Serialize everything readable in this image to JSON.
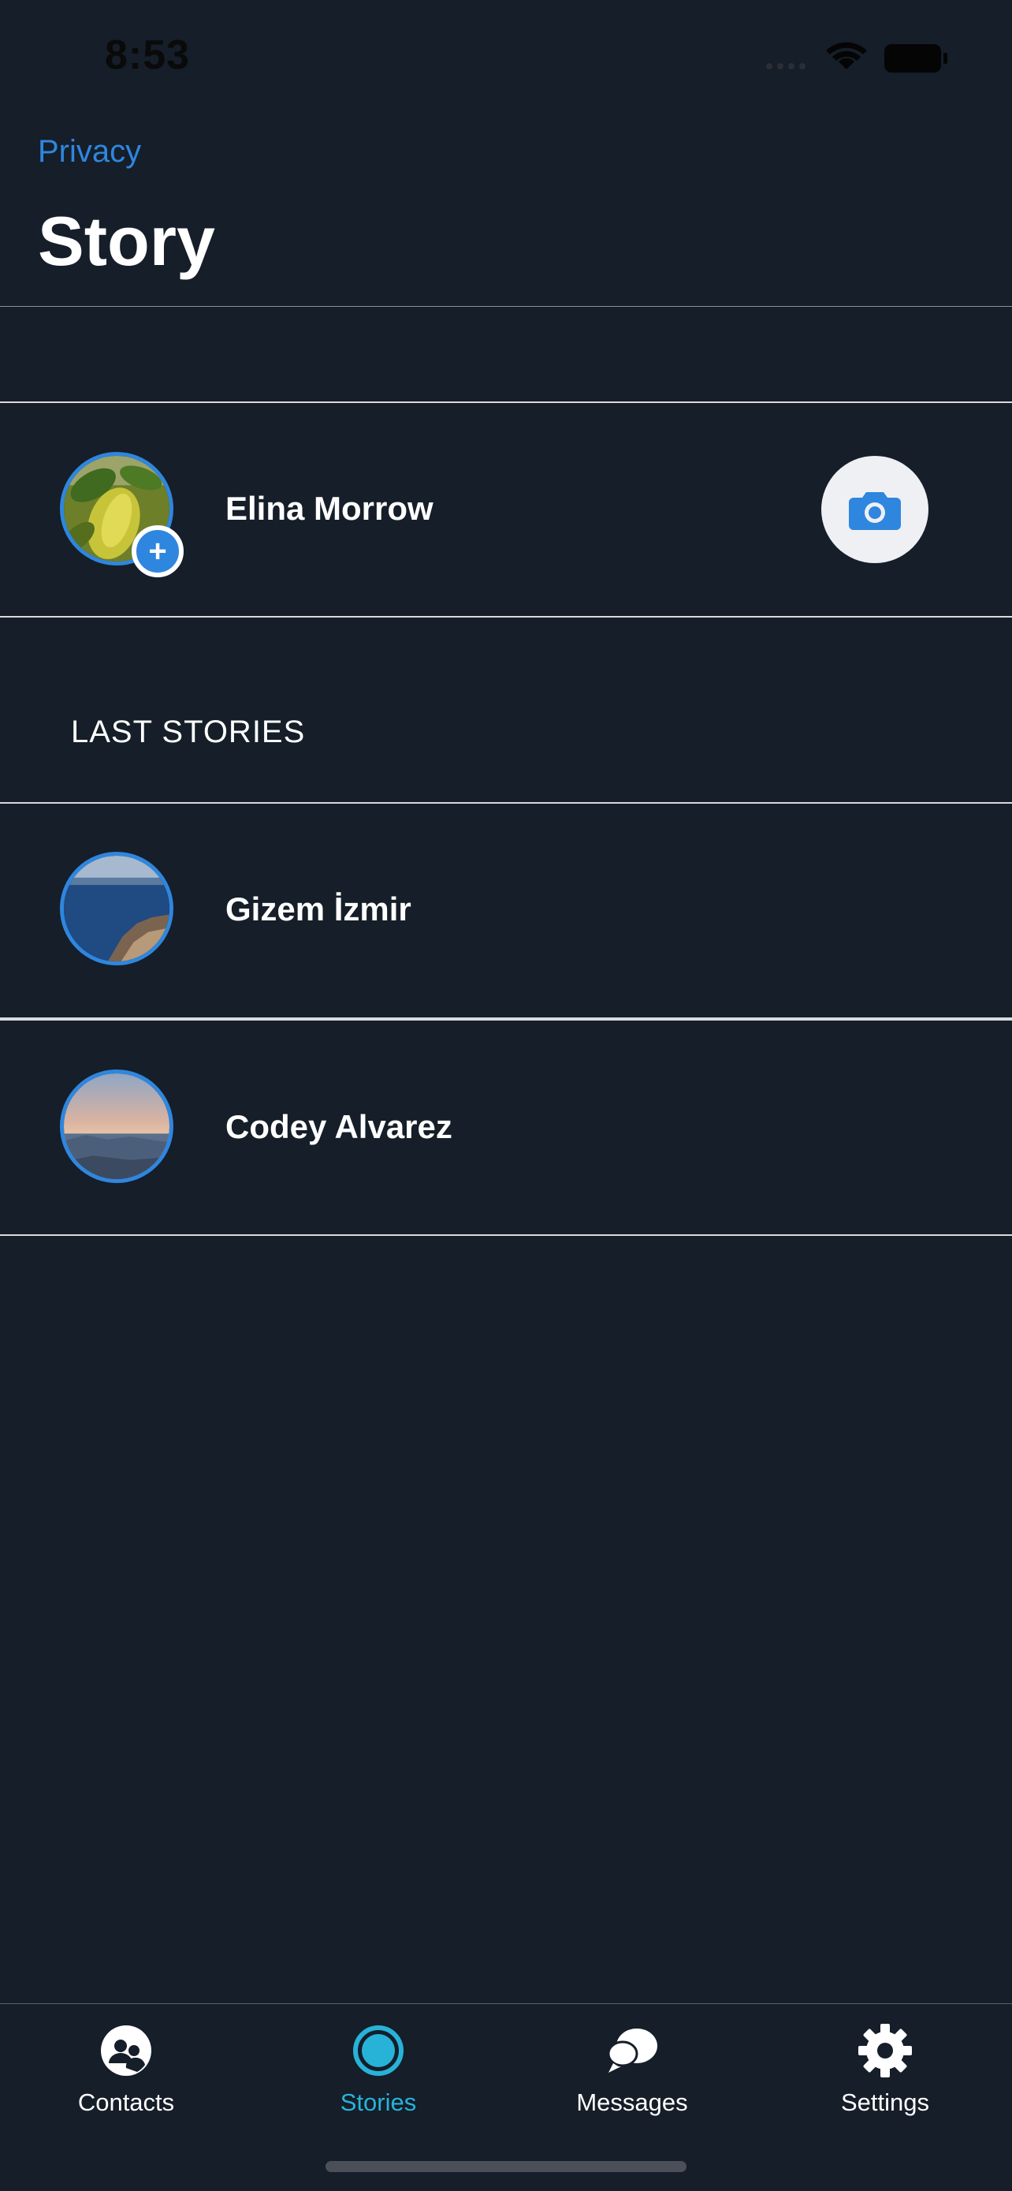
{
  "status_bar": {
    "time": "8:53"
  },
  "header": {
    "back_link": "Privacy",
    "title": "Story"
  },
  "my_story": {
    "name": "Elina Morrow",
    "add_badge": "+",
    "camera_icon": "camera-icon"
  },
  "last_stories": {
    "section_title": "LAST STORIES",
    "items": [
      {
        "name": "Gizem İzmir"
      },
      {
        "name": "Codey Alvarez"
      }
    ]
  },
  "tabbar": {
    "tabs": [
      {
        "label": "Contacts",
        "icon": "contacts-icon",
        "active": false
      },
      {
        "label": "Stories",
        "icon": "stories-icon",
        "active": true
      },
      {
        "label": "Messages",
        "icon": "messages-icon",
        "active": false
      },
      {
        "label": "Settings",
        "icon": "gear-icon",
        "active": false
      }
    ]
  },
  "colors": {
    "background": "#151e29",
    "accent": "#2f86de",
    "active_tab": "#27b3d8",
    "text": "#ffffff"
  }
}
